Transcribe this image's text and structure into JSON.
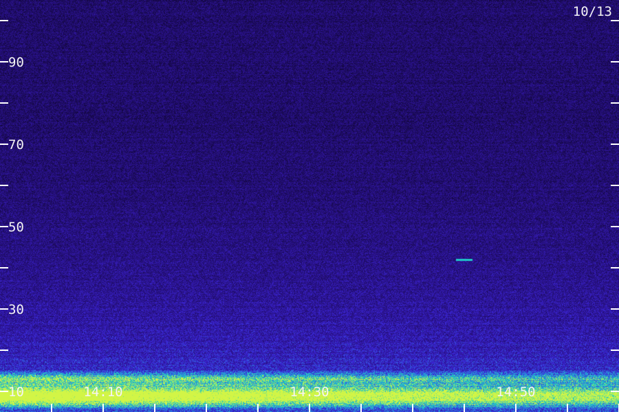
{
  "chart_data": {
    "type": "heatmap",
    "title": "",
    "date_label": "10/13",
    "y_axis": {
      "ylim": [
        5,
        105
      ],
      "tick_values": [
        10,
        20,
        30,
        40,
        50,
        60,
        70,
        80,
        90,
        100
      ],
      "tick_labels": [
        {
          "value": 10,
          "text": "10"
        },
        {
          "value": 30,
          "text": "30"
        },
        {
          "value": 50,
          "text": "50"
        },
        {
          "value": 70,
          "text": "70"
        },
        {
          "value": 90,
          "text": "90"
        }
      ]
    },
    "x_axis": {
      "minor_tick_step_min": 5,
      "tick_labels": [
        "14:10",
        "14:30",
        "14:50"
      ]
    },
    "features": [
      {
        "kind": "band",
        "value": 13,
        "intensity": 0.8
      },
      {
        "kind": "band",
        "value": 10,
        "intensity": 0.95
      },
      {
        "kind": "band",
        "value": 8,
        "intensity": 1.0
      },
      {
        "kind": "spot",
        "time": "14:45",
        "value": 42,
        "intensity": 0.9
      }
    ],
    "colors": {
      "background_low": "#1a0a55",
      "mid": "#3a2bd8",
      "high": "#1ec8c8",
      "peak": "#c8f040",
      "axis": "#ffffff"
    }
  }
}
